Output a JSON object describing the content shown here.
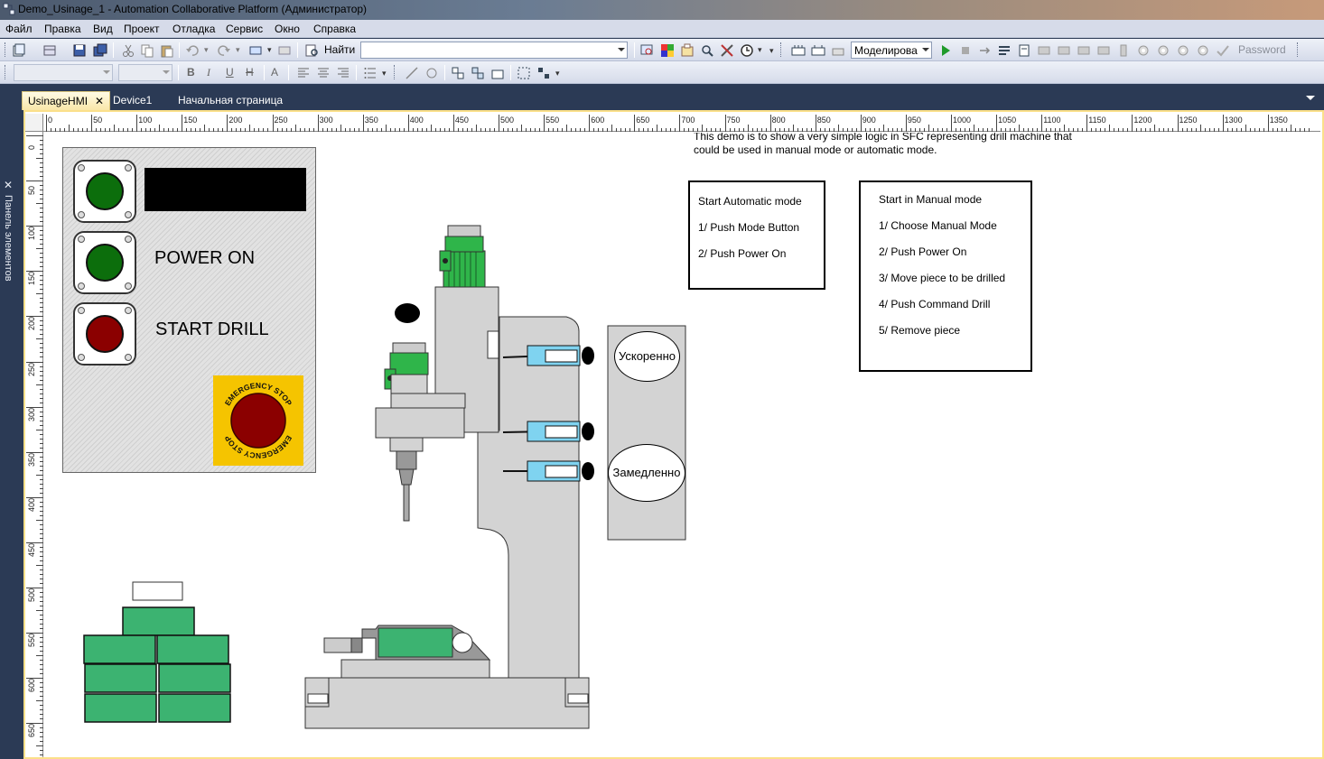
{
  "window": {
    "title": "Demo_Usinage_1 - Automation Collaborative Platform (Администратор)"
  },
  "menu": [
    "Файл",
    "Правка",
    "Вид",
    "Проект",
    "Отладка",
    "Сервис",
    "Окно",
    "Справка"
  ],
  "toolbar": {
    "find_label": "Найти",
    "find_value": "",
    "mode_value": "Моделирова",
    "password_label": "Password"
  },
  "dock": {
    "panel_label": "Панель элементов"
  },
  "tabs": [
    {
      "label": "UsinageHMI",
      "close": "✕"
    },
    {
      "label": "Device1"
    },
    {
      "label": "Начальная страница"
    }
  ],
  "ruler": {
    "top": [
      "0",
      "50",
      "100",
      "150",
      "200",
      "250",
      "300",
      "350",
      "400",
      "450",
      "500",
      "550",
      "600",
      "650",
      "700",
      "750",
      "800",
      "850",
      "900",
      "950",
      "1000",
      "1050",
      "1100",
      "1150",
      "1200",
      "1250",
      "1300",
      "1350"
    ],
    "left": [
      "0",
      "50",
      "100",
      "150",
      "200",
      "250",
      "300",
      "350",
      "400",
      "450",
      "500",
      "550",
      "600",
      "650"
    ]
  },
  "hmi": {
    "demo_note": "This demo is to show a very simple logic in SFC representing  drill machine that could be used in manual mode or automatic mode.",
    "auto_box": [
      "Start Automatic mode",
      "1/ Push Mode Button",
      "2/ Push Power On"
    ],
    "manual_box": [
      "Start in Manual mode",
      "1/ Choose Manual Mode",
      "2/ Push Power On",
      "3/ Move piece to be drilled",
      "4/ Push Command Drill",
      "5/ Remove piece"
    ],
    "power_on_label": "POWER ON",
    "start_drill_label": "START DRILL",
    "estop_text_top": "EMERGENCY STOP",
    "estop_text_bottom": "EMERGENCY STOP",
    "fast_label": "Ускоренно",
    "slow_label": "Замедленно",
    "colors": {
      "green_lamp": "#0c6e0c",
      "red_lamp": "#8b0000",
      "motor_green": "#2fb54a",
      "brick_green": "#3cb371",
      "valve_blue": "#7fd3f0",
      "estop_yellow": "#f5c400"
    }
  }
}
